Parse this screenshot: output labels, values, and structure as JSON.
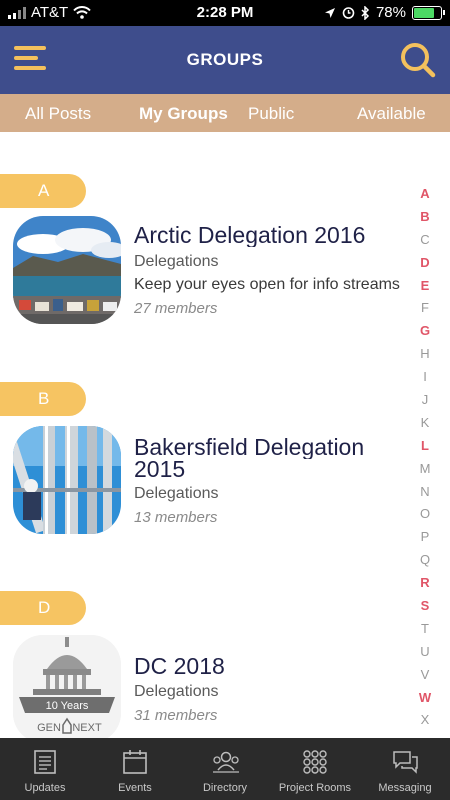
{
  "status": {
    "carrier": "AT&T",
    "time": "2:28 PM",
    "battery": "78%"
  },
  "header": {
    "title": "GROUPS"
  },
  "tabs": [
    {
      "label": "All Posts",
      "active": false
    },
    {
      "label": "My Groups",
      "active": true
    },
    {
      "label": "Public",
      "active": false
    },
    {
      "label": "Available",
      "active": false
    }
  ],
  "sections": [
    {
      "letter": "A",
      "groups": [
        {
          "name": "Arctic Delegation 2016",
          "category": "Delegations",
          "description": "Keep your eyes open for info streams",
          "members": "27 members"
        }
      ]
    },
    {
      "letter": "B",
      "groups": [
        {
          "name": "Bakersfield Delegation 2015",
          "name_line1": "Bakersfield Delegation",
          "name_line2": "2015",
          "category": "Delegations",
          "members": "13 members"
        }
      ]
    },
    {
      "letter": "D",
      "groups": [
        {
          "name": "DC 2018",
          "category": "Delegations",
          "members": "31 members",
          "logo_text": [
            "10 Years",
            "GEN",
            "NEXT"
          ]
        }
      ]
    }
  ],
  "alphabet": {
    "letters": [
      "A",
      "B",
      "C",
      "D",
      "E",
      "F",
      "G",
      "H",
      "I",
      "J",
      "K",
      "L",
      "M",
      "N",
      "O",
      "P",
      "Q",
      "R",
      "S",
      "T",
      "U",
      "V",
      "W",
      "X"
    ],
    "highlighted": [
      "A",
      "B",
      "D",
      "E",
      "G",
      "L",
      "R",
      "S",
      "W"
    ],
    "highlight_color": "#e05668"
  },
  "bottom_nav": [
    {
      "label": "Updates",
      "icon": "updates-icon"
    },
    {
      "label": "Events",
      "icon": "calendar-icon"
    },
    {
      "label": "Directory",
      "icon": "people-icon"
    },
    {
      "label": "Project Rooms",
      "icon": "grid-icon"
    },
    {
      "label": "Messaging",
      "icon": "chat-icon"
    }
  ],
  "colors": {
    "header": "#3e4d8c",
    "tabs": "#d4ad8a",
    "accent": "#f6c462",
    "title_text": "#1f2147",
    "tabbar": "#2b2b2b"
  }
}
